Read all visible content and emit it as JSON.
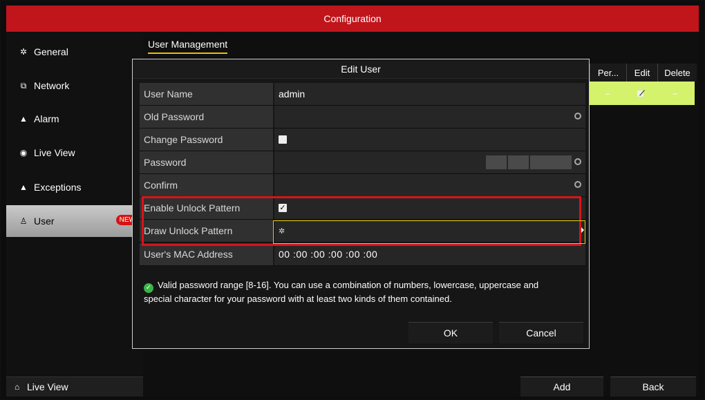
{
  "window": {
    "title": "Configuration"
  },
  "sidebar": {
    "items": [
      {
        "label": "General",
        "icon": "gear-icon"
      },
      {
        "label": "Network",
        "icon": "network-icon"
      },
      {
        "label": "Alarm",
        "icon": "alarm-icon"
      },
      {
        "label": "Live View",
        "icon": "eye-icon"
      },
      {
        "label": "Exceptions",
        "icon": "warning-icon"
      },
      {
        "label": "User",
        "icon": "user-icon",
        "badge": "NEW",
        "active": true
      }
    ],
    "bottom_label": "Live View"
  },
  "main": {
    "tab_label": "User Management",
    "columns": [
      "Per...",
      "Edit",
      "Delete"
    ],
    "row": {
      "per": "–",
      "delete": "–"
    },
    "add_label": "Add",
    "back_label": "Back"
  },
  "dialog": {
    "title": "Edit User",
    "fields": {
      "user_name": {
        "label": "User Name",
        "value": "admin"
      },
      "old_password": {
        "label": "Old Password",
        "value": ""
      },
      "change_password": {
        "label": "Change Password",
        "checked": false
      },
      "password": {
        "label": "Password",
        "value": ""
      },
      "confirm": {
        "label": "Confirm",
        "value": ""
      },
      "enable_unlock": {
        "label": "Enable Unlock Pattern",
        "checked": true
      },
      "draw_unlock": {
        "label": "Draw Unlock Pattern"
      },
      "mac": {
        "label": "User's MAC Address",
        "value": "00 :00 :00 :00 :00 :00"
      }
    },
    "info_text": "Valid password range [8-16]. You can use a combination of numbers, lowercase, uppercase and special character for your password with at least two kinds of them contained.",
    "ok_label": "OK",
    "cancel_label": "Cancel"
  },
  "colors": {
    "title_bar": "#c0151b",
    "selected_row": "#d4f26c",
    "highlight_red": "#d8131a",
    "highlight_yellow": "#e3d100"
  }
}
